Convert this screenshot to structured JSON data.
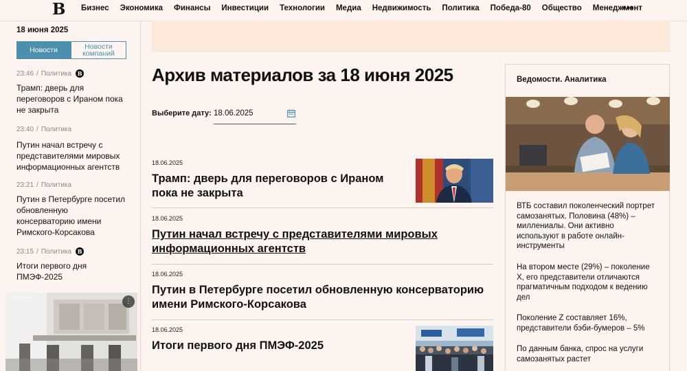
{
  "header": {
    "logo": "В",
    "nav": [
      "Бизнес",
      "Экономика",
      "Финансы",
      "Инвестиции",
      "Технологии",
      "Медиа",
      "Недвижимость",
      "Политика",
      "Победа-80",
      "Общество",
      "Менеджмент"
    ],
    "more": "•••"
  },
  "sidebar": {
    "date": "18 июня 2025",
    "tabs": {
      "news": "Новости",
      "company_news": "Новости компаний"
    },
    "items": [
      {
        "time": "23:46",
        "rubric": "Политика",
        "badge": "В",
        "title": "Трамп: дверь для переговоров с Ираном пока не закрыта"
      },
      {
        "time": "23:40",
        "rubric": "Политика",
        "badge": "",
        "title": "Путин начал встречу с представителями мировых информационных агентств"
      },
      {
        "time": "23:21",
        "rubric": "Политика",
        "badge": "",
        "title": "Путин в Петербурге посетил обновленную консерваторию имени Римского-Корсакова"
      },
      {
        "time": "23:15",
        "rubric": "Политика",
        "badge": "В",
        "title": "Итоги первого дня ПМЭФ-2025"
      }
    ],
    "separator": "/",
    "ad_label": "РЕКЛАМА",
    "ad_menu": "⋮"
  },
  "main": {
    "title": "Архив материалов за 18 июня 2025",
    "date_label": "Выберите дату:",
    "date_value": "18.06.2025",
    "articles": [
      {
        "date": "18.06.2025",
        "title": "Трамп: дверь для переговоров с Ираном пока не закрыта"
      },
      {
        "date": "18.06.2025",
        "title": "Путин начал встречу с представителями мировых информационных агентств"
      },
      {
        "date": "18.06.2025",
        "title": "Путин в Петербурге посетил обновленную консерваторию имени Римского-Корсакова"
      },
      {
        "date": "18.06.2025",
        "title": "Итоги первого дня ПМЭФ-2025"
      }
    ]
  },
  "analytics": {
    "title": "Ведомости. Аналитика",
    "paragraphs": [
      "ВТБ составил поколенческий портрет самозанятых. Половина (48%) – миллениалы. Они активно используют в работе онлайн-инструменты",
      "На втором месте (29%) – поколение X, его представители отличаются прагматичным подходом к ведению дел",
      "Поколение Z составляет 16%, представители бэби-бумеров – 5%",
      "По данным банка, спрос на услуги самозанятых растет"
    ]
  },
  "colors": {
    "background": "#fdf4ef",
    "accent": "#4e8fad",
    "banner": "#fde8da"
  }
}
